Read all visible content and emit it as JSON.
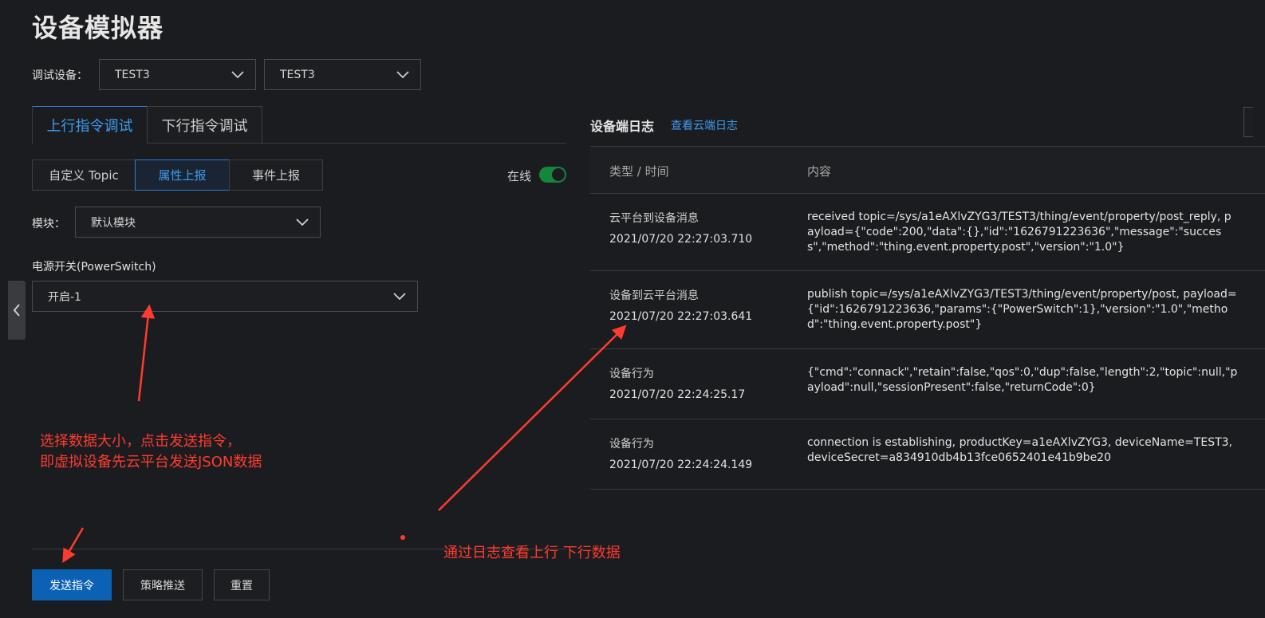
{
  "page_title": "设备模拟器",
  "device": {
    "label": "调试设备：",
    "product_select": "TEST3",
    "device_select": "TEST3"
  },
  "tabs": [
    {
      "label": "上行指令调试",
      "active": true
    },
    {
      "label": "下行指令调试",
      "active": false
    }
  ],
  "segments": [
    {
      "label": "自定义 Topic",
      "active": false
    },
    {
      "label": "属性上报",
      "active": true
    },
    {
      "label": "事件上报",
      "active": false
    }
  ],
  "status": {
    "label": "在线",
    "online": true
  },
  "module": {
    "label": "模块：",
    "value": "默认模块"
  },
  "property": {
    "label": "电源开关(PowerSwitch)",
    "value": "开启-1"
  },
  "buttons": {
    "send": "发送指令",
    "strategy": "策略推送",
    "reset": "重置"
  },
  "log": {
    "title": "设备端日志",
    "cloud_link": "查看云端日志",
    "col_type": "类型 / 时间",
    "col_content": "内容",
    "rows": [
      {
        "type": "云平台到设备消息",
        "time": "2021/07/20 22:27:03.710",
        "content": "received topic=/sys/a1eAXlvZYG3/TEST3/thing/event/property/post_reply, payload={\"code\":200,\"data\":{},\"id\":\"1626791223636\",\"message\":\"success\",\"method\":\"thing.event.property.post\",\"version\":\"1.0\"}"
      },
      {
        "type": "设备到云平台消息",
        "time": "2021/07/20 22:27:03.641",
        "content": "publish topic=/sys/a1eAXlvZYG3/TEST3/thing/event/property/post, payload={\"id\":1626791223636,\"params\":{\"PowerSwitch\":1},\"version\":\"1.0\",\"method\":\"thing.event.property.post\"}"
      },
      {
        "type": "设备行为",
        "time": "2021/07/20 22:24:25.17",
        "content": "{\"cmd\":\"connack\",\"retain\":false,\"qos\":0,\"dup\":false,\"length\":2,\"topic\":null,\"payload\":null,\"sessionPresent\":false,\"returnCode\":0}"
      },
      {
        "type": "设备行为",
        "time": "2021/07/20 22:24:24.149",
        "content": "connection is establishing, productKey=a1eAXlvZYG3, deviceName=TEST3, deviceSecret=a834910db4b13fce0652401e41b9be20"
      }
    ]
  },
  "annotations": {
    "left_line1": "选择数据大小，点击发送指令，",
    "left_line2": "即虚拟设备先云平台发送JSON数据",
    "right": "通过日志查看上行 下行数据"
  },
  "colors": {
    "background": "#1b1c1f",
    "accent": "#3d9bf0",
    "primary_button": "#0b62b5",
    "online_toggle": "#14873d",
    "annotation": "#ff3b30"
  }
}
